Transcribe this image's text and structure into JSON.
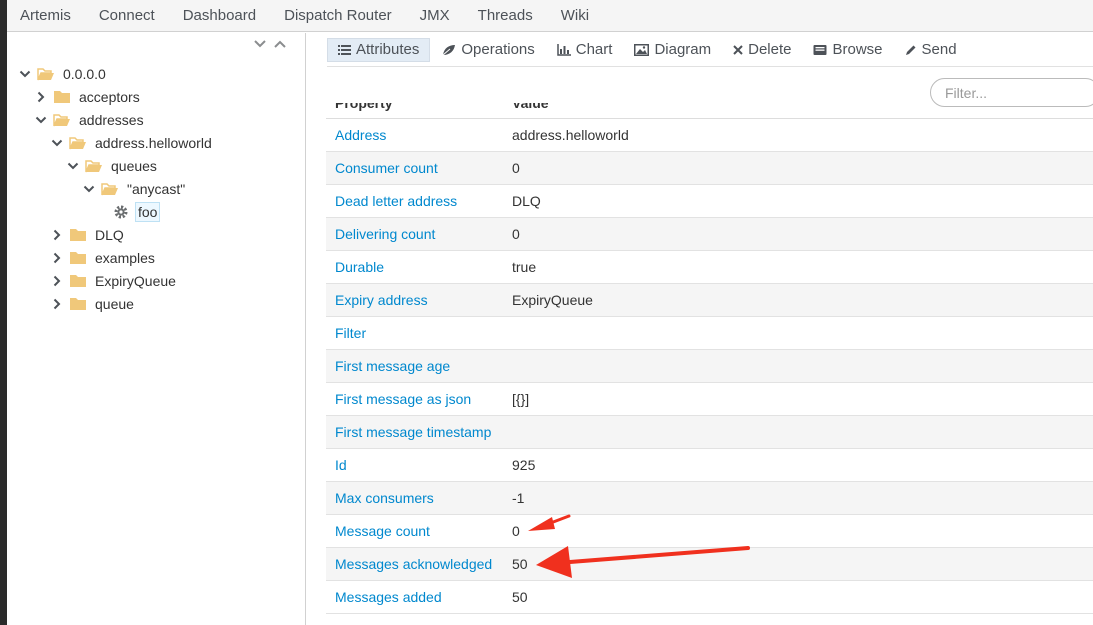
{
  "nav": {
    "items": [
      "Artemis",
      "Connect",
      "Dashboard",
      "Dispatch Router",
      "JMX",
      "Threads",
      "Wiki"
    ]
  },
  "tree": {
    "nodes": [
      {
        "label": "0.0.0.0",
        "state": "expanded",
        "folder": "open"
      },
      {
        "label": "acceptors",
        "state": "collapsed",
        "folder": "closed"
      },
      {
        "label": "addresses",
        "state": "expanded",
        "folder": "open"
      },
      {
        "label": "address.helloworld",
        "state": "expanded",
        "folder": "open"
      },
      {
        "label": "queues",
        "state": "expanded",
        "folder": "open"
      },
      {
        "label": "\"anycast\"",
        "state": "expanded",
        "folder": "open"
      },
      {
        "label": "foo",
        "state": "leaf",
        "folder": "gear",
        "selected": true
      },
      {
        "label": "DLQ",
        "state": "collapsed",
        "folder": "closed"
      },
      {
        "label": "examples",
        "state": "collapsed",
        "folder": "closed"
      },
      {
        "label": "ExpiryQueue",
        "state": "collapsed",
        "folder": "closed"
      },
      {
        "label": "queue",
        "state": "collapsed",
        "folder": "closed"
      }
    ]
  },
  "toolbar": {
    "attributes": "Attributes",
    "operations": "Operations",
    "chart": "Chart",
    "diagram": "Diagram",
    "delete": "Delete",
    "browse": "Browse",
    "send": "Send"
  },
  "filter": {
    "placeholder": "Filter..."
  },
  "table": {
    "header_property": "Property",
    "header_value": "Value",
    "rows": [
      {
        "name": "Address",
        "value": "address.helloworld"
      },
      {
        "name": "Consumer count",
        "value": "0"
      },
      {
        "name": "Dead letter address",
        "value": "DLQ"
      },
      {
        "name": "Delivering count",
        "value": "0"
      },
      {
        "name": "Durable",
        "value": "true"
      },
      {
        "name": "Expiry address",
        "value": "ExpiryQueue"
      },
      {
        "name": "Filter",
        "value": ""
      },
      {
        "name": "First message age",
        "value": ""
      },
      {
        "name": "First message as json",
        "value": "[{}]"
      },
      {
        "name": "First message timestamp",
        "value": ""
      },
      {
        "name": "Id",
        "value": "925"
      },
      {
        "name": "Max consumers",
        "value": "-1"
      },
      {
        "name": "Message count",
        "value": "0"
      },
      {
        "name": "Messages acknowledged",
        "value": "50"
      },
      {
        "name": "Messages added",
        "value": "50"
      }
    ]
  },
  "colors": {
    "link": "#0088ce",
    "folder": "#f0c87a",
    "arrow": "#f0301e"
  }
}
